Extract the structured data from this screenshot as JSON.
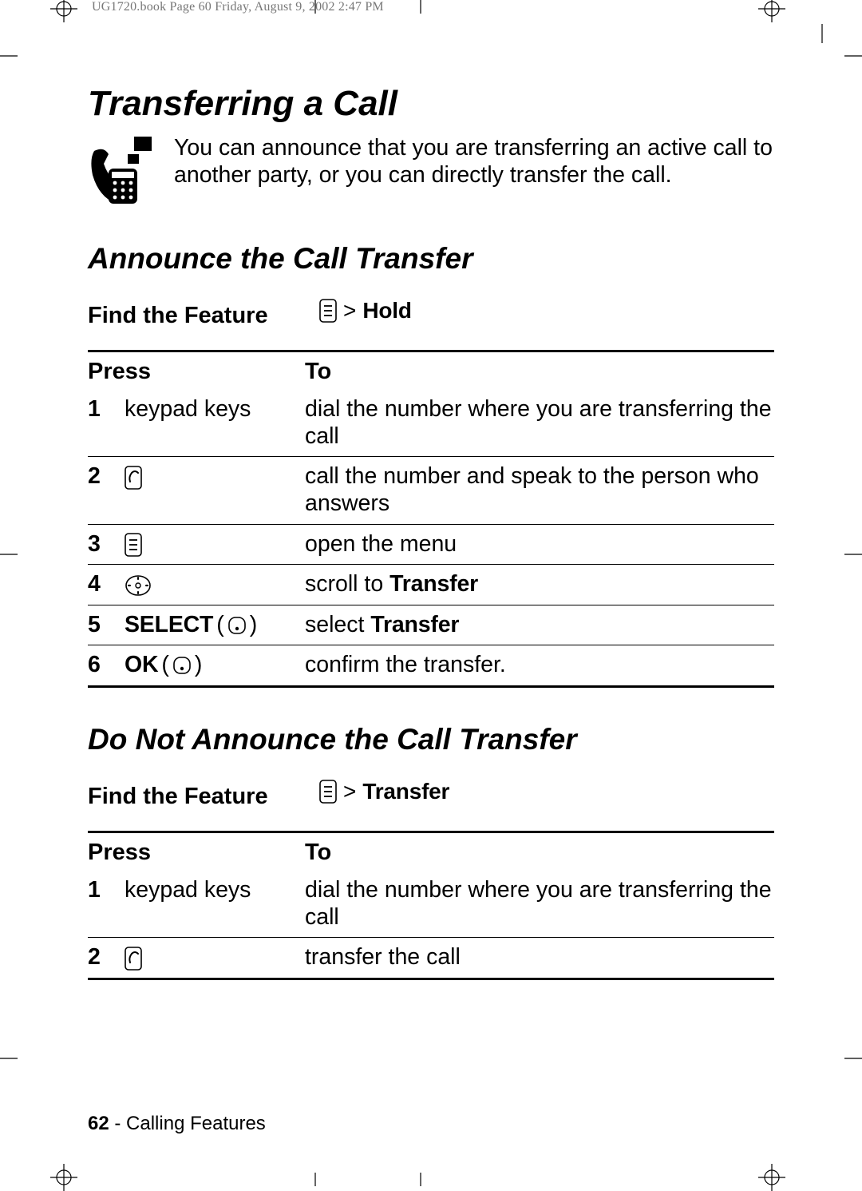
{
  "headerTrace": "UG1720.book  Page 60  Friday, August 9, 2002  2:47 PM",
  "title": "Transferring a Call",
  "intro": "You can announce that you are transferring an active call to another party, or you can directly transfer the call.",
  "section1": {
    "heading": "Announce the Call Transfer",
    "findFeatureLabel": "Find the Feature",
    "menuTarget": "Hold",
    "headers": {
      "press": "Press",
      "to": "To"
    },
    "rows": [
      {
        "num": "1",
        "press": {
          "type": "text",
          "text": "keypad keys"
        },
        "to": "dial the number where you are transferring the call"
      },
      {
        "num": "2",
        "press": {
          "type": "icon",
          "icon": "send"
        },
        "to": "call the number and speak to the person who answers"
      },
      {
        "num": "3",
        "press": {
          "type": "icon",
          "icon": "menu"
        },
        "to": "open the menu"
      },
      {
        "num": "4",
        "press": {
          "type": "icon",
          "icon": "nav"
        },
        "to_pre": "scroll to ",
        "to_bold": "Transfer"
      },
      {
        "num": "5",
        "press": {
          "type": "soft",
          "label": "SELECT"
        },
        "to_pre": "select ",
        "to_bold": "Transfer"
      },
      {
        "num": "6",
        "press": {
          "type": "soft",
          "label": "OK"
        },
        "to": "confirm the transfer."
      }
    ]
  },
  "section2": {
    "heading": "Do Not Announce the Call Transfer",
    "findFeatureLabel": "Find the Feature",
    "menuTarget": "Transfer",
    "headers": {
      "press": "Press",
      "to": "To"
    },
    "rows": [
      {
        "num": "1",
        "press": {
          "type": "text",
          "text": "keypad keys"
        },
        "to": "dial the number where you are transferring the call"
      },
      {
        "num": "2",
        "press": {
          "type": "icon",
          "icon": "send"
        },
        "to": "transfer the call"
      }
    ]
  },
  "footer": {
    "page": "62",
    "section": "Calling Features"
  }
}
